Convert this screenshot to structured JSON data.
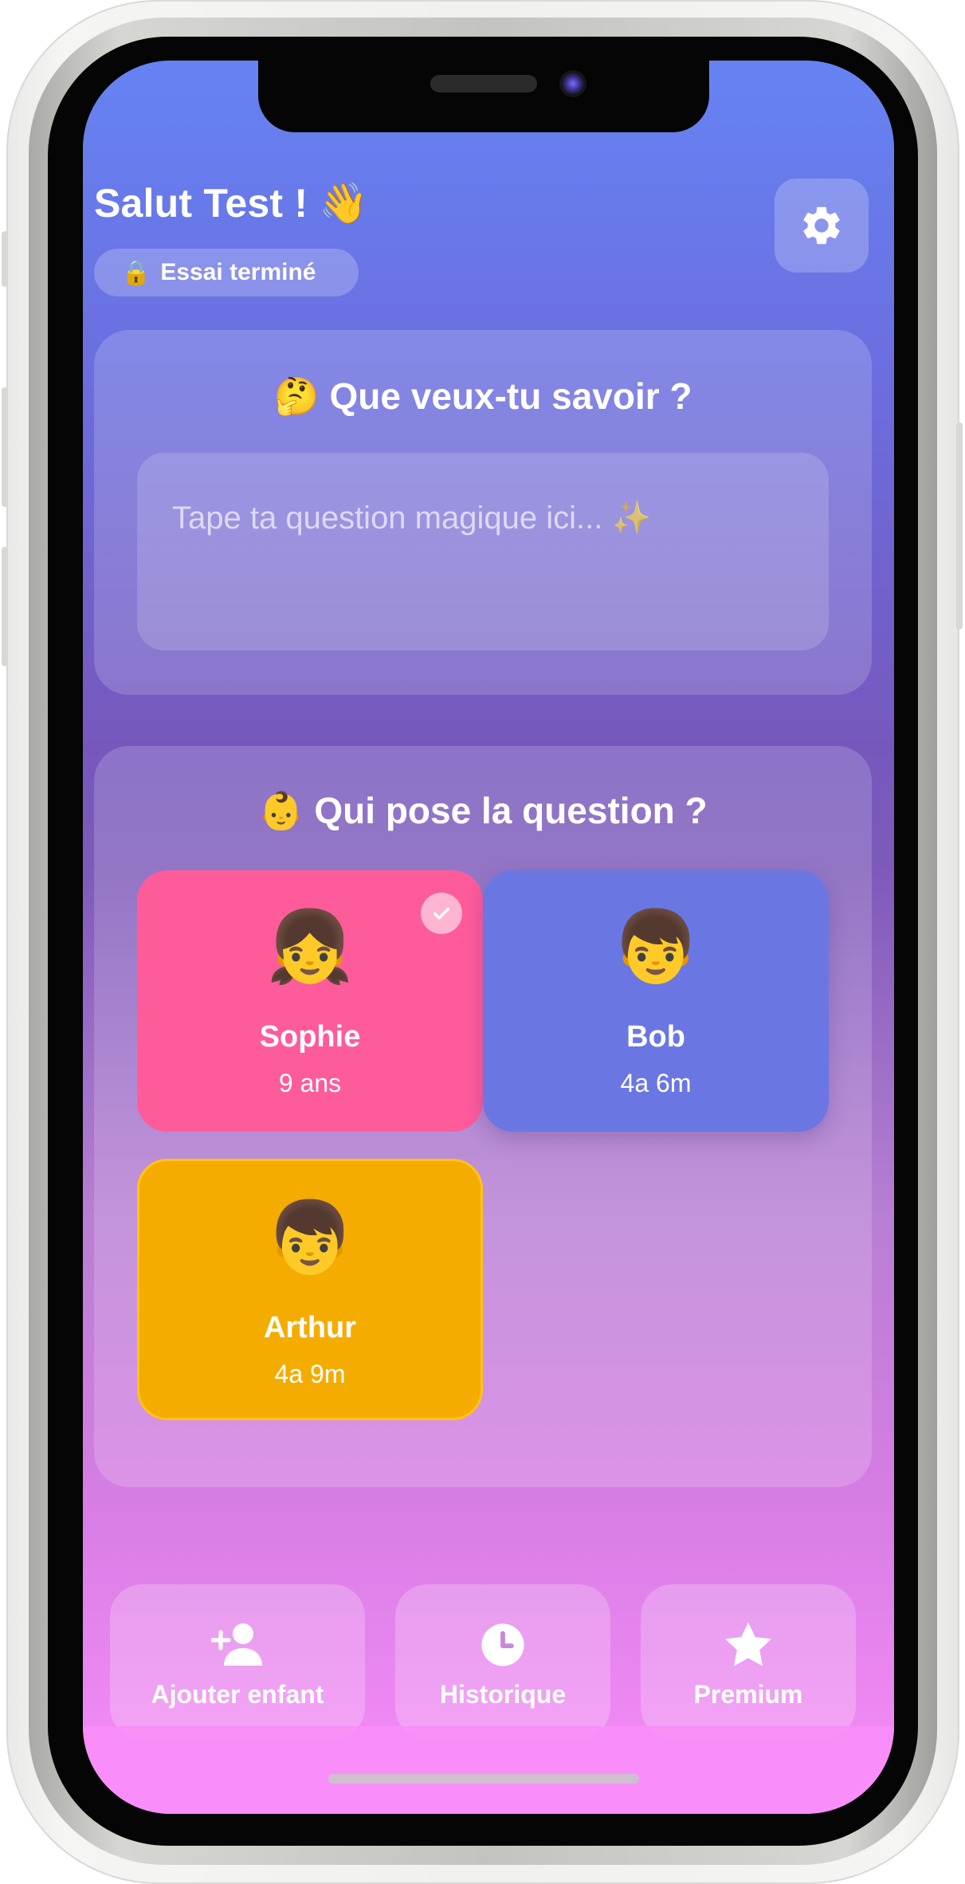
{
  "header": {
    "greeting": "Salut Test ! 👋",
    "trial_icon": "🔒",
    "trial_label": "Essai terminé",
    "settings_icon": "gear-icon"
  },
  "question_card": {
    "title": "🤔 Que veux-tu savoir ?",
    "input_value": "",
    "input_placeholder": "Tape ta question magique ici... ✨"
  },
  "who_card": {
    "title": "👶 Qui pose la question ?",
    "children": [
      {
        "emoji": "👧",
        "name": "Sophie",
        "age": "9 ans",
        "color": "#fe5b9b",
        "selected": true
      },
      {
        "emoji": "👦",
        "name": "Bob",
        "age": "4a 6m",
        "color": "#6a77e2",
        "selected": false
      },
      {
        "emoji": "👦",
        "name": "Arthur",
        "age": "4a 9m",
        "color": "#f5ac00",
        "selected": false
      }
    ]
  },
  "bottom_actions": [
    {
      "icon": "add-user-icon",
      "label": "Ajouter enfant"
    },
    {
      "icon": "clock-icon",
      "label": "Historique"
    },
    {
      "icon": "star-icon",
      "label": "Premium"
    }
  ]
}
